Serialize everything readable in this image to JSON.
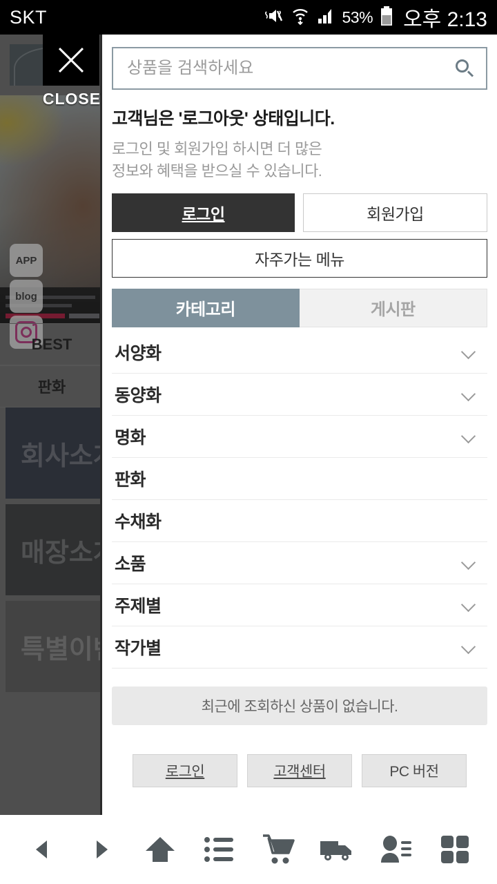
{
  "statusbar": {
    "carrier": "SKT",
    "battery_percent": "53%",
    "clock": "오후 2:13",
    "icons": [
      "mute-icon",
      "wifi-icon",
      "signal-icon",
      "battery-icon"
    ]
  },
  "background_page": {
    "close_label": "CLOSE",
    "close_icon": "close-x-icon",
    "side_buttons": [
      {
        "label": "APP",
        "icon": "app-icon"
      },
      {
        "label": "blog",
        "icon": "blog-icon"
      },
      {
        "label": "",
        "icon": "instagram-icon"
      }
    ],
    "nav_rows": [
      "BEST",
      "판화"
    ],
    "cards": [
      "회사소개",
      "매장소개",
      "특별이벤트"
    ]
  },
  "panel": {
    "search": {
      "placeholder": "상품을 검색하세요",
      "value": "",
      "icon": "search-icon"
    },
    "account": {
      "title": "고객님은 '로그아웃' 상태입니다.",
      "desc_line1": "로그인 및 회원가입 하시면 더 많은",
      "desc_line2": "정보와 혜택을 받으실 수 있습니다.",
      "login_label": "로그인",
      "join_label": "회원가입",
      "favorite_menu_label": "자주가는 메뉴"
    },
    "tabs": [
      {
        "label": "카테고리",
        "active": true
      },
      {
        "label": "게시판",
        "active": false
      }
    ],
    "categories": [
      {
        "label": "서양화",
        "expandable": true
      },
      {
        "label": "동양화",
        "expandable": true
      },
      {
        "label": "명화",
        "expandable": true
      },
      {
        "label": "판화",
        "expandable": false
      },
      {
        "label": "수채화",
        "expandable": false
      },
      {
        "label": "소품",
        "expandable": true
      },
      {
        "label": "주제별",
        "expandable": true
      },
      {
        "label": "작가별",
        "expandable": true
      }
    ],
    "recent_notice": "최근에 조회하신 상품이 없습니다.",
    "footer_buttons": [
      {
        "label": "로그인",
        "underline": true
      },
      {
        "label": "고객센터",
        "underline": true
      },
      {
        "label": "PC 버전",
        "underline": false
      }
    ]
  },
  "bottom_nav": [
    {
      "name": "back-icon"
    },
    {
      "name": "forward-icon"
    },
    {
      "name": "home-up-arrow-icon"
    },
    {
      "name": "list-icon"
    },
    {
      "name": "cart-icon"
    },
    {
      "name": "delivery-truck-icon"
    },
    {
      "name": "my-page-person-icon"
    },
    {
      "name": "grid-menu-icon"
    }
  ],
  "colors": {
    "accent_tab": "#7e919c",
    "login_button": "#333333",
    "panel_border": "#2b2b2b",
    "search_border": "#8b9aa3",
    "notice_bg": "#e9e9e9"
  }
}
